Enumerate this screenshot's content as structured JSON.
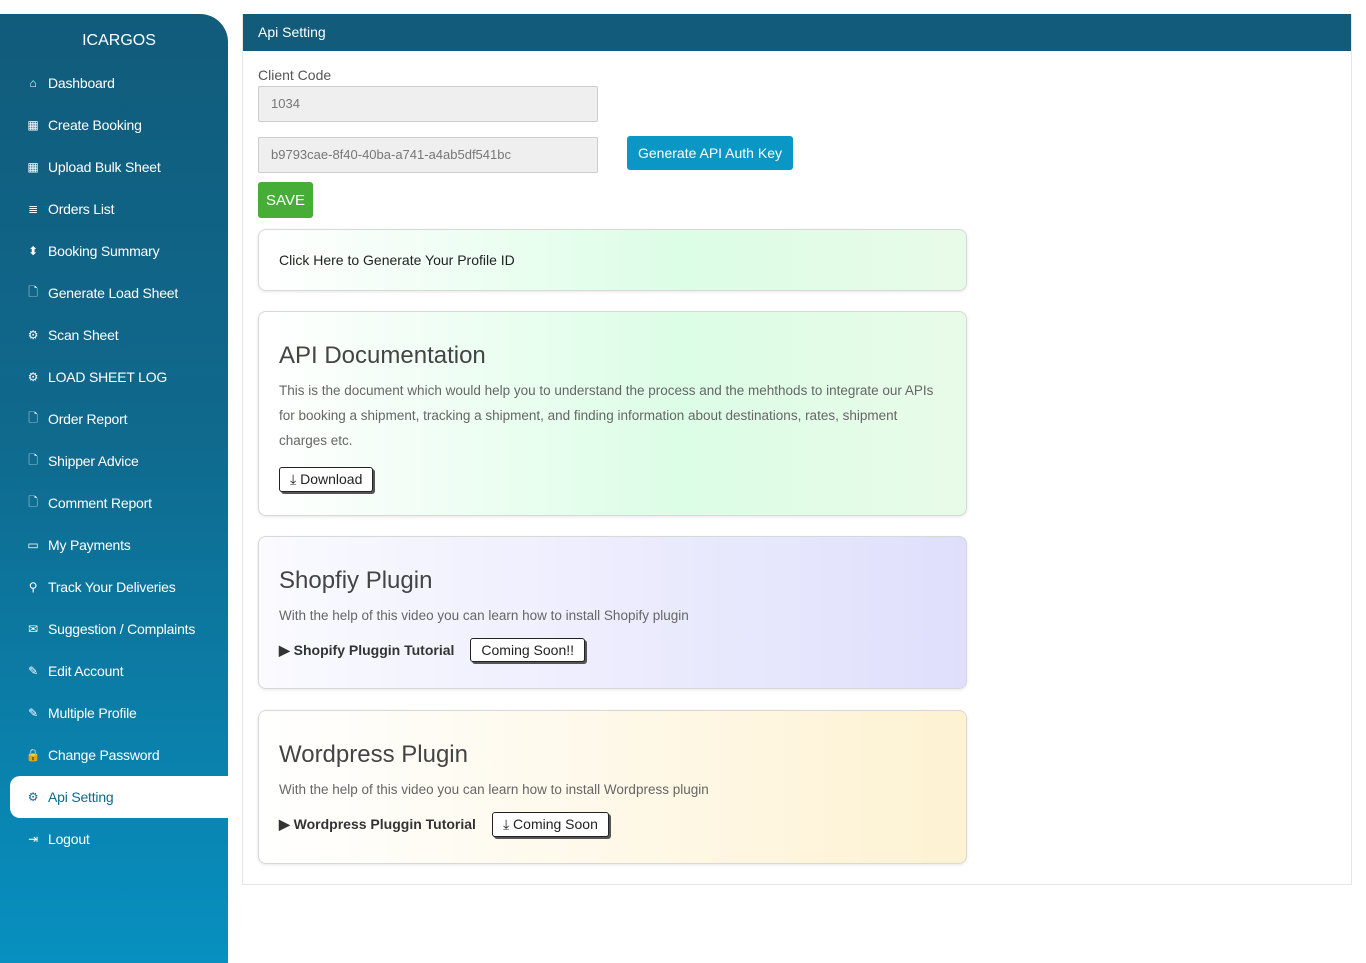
{
  "sidebar": {
    "brand": "ICARGOS",
    "items": [
      {
        "label": "Dashboard",
        "icon": "home-icon",
        "glyph": "⌂"
      },
      {
        "label": "Create Booking",
        "icon": "calendar-icon",
        "glyph": "▦"
      },
      {
        "label": "Upload Bulk Sheet",
        "icon": "calendar-icon",
        "glyph": "▦"
      },
      {
        "label": "Orders List",
        "icon": "list-icon",
        "glyph": "≣"
      },
      {
        "label": "Booking Summary",
        "icon": "sort-icon",
        "glyph": "⬍"
      },
      {
        "label": "Generate Load Sheet",
        "icon": "file-icon",
        "glyph": "🗋"
      },
      {
        "label": "Scan Sheet",
        "icon": "gear-icon",
        "glyph": "⚙"
      },
      {
        "label": "LOAD SHEET LOG",
        "icon": "gear-icon",
        "glyph": "⚙"
      },
      {
        "label": "Order Report",
        "icon": "file-icon",
        "glyph": "🗋"
      },
      {
        "label": "Shipper Advice",
        "icon": "file-icon",
        "glyph": "🗋"
      },
      {
        "label": "Comment Report",
        "icon": "file-icon",
        "glyph": "🗋"
      },
      {
        "label": "My Payments",
        "icon": "wallet-icon",
        "glyph": "▭"
      },
      {
        "label": "Track Your Deliveries",
        "icon": "location-icon",
        "glyph": "⚲"
      },
      {
        "label": "Suggestion / Complaints",
        "icon": "mail-icon",
        "glyph": "✉"
      },
      {
        "label": "Edit Account",
        "icon": "pencil-icon",
        "glyph": "✎"
      },
      {
        "label": "Multiple Profile",
        "icon": "pencil-icon",
        "glyph": "✎"
      },
      {
        "label": "Change Password",
        "icon": "lock-icon",
        "glyph": "🔒"
      },
      {
        "label": "Api Setting",
        "icon": "gear-icon",
        "glyph": "⚙",
        "active": true
      },
      {
        "label": "Logout",
        "icon": "logout-icon",
        "glyph": "⇥"
      }
    ]
  },
  "header": {
    "title": "Api Setting"
  },
  "form": {
    "client_code_label": "Client Code",
    "client_code": "1034",
    "api_key": "b9793cae-8f40-40ba-a741-a4ab5df541bc",
    "generate_label": "Generate API Auth Key",
    "save_label": "SAVE"
  },
  "profile_card": {
    "text": "Click Here to Generate Your Profile ID"
  },
  "api_doc": {
    "title": "API Documentation",
    "text": "This is the document which would help you to understand the process and the mehthods to integrate our APIs for booking a shipment, tracking a shipment, and finding information about destinations, rates, shipment charges etc.",
    "button": "Download"
  },
  "shopify": {
    "title": "Shopfiy Plugin",
    "text": "With the help of this video you can learn how to install Shopify plugin",
    "tutorial": "Shopify Pluggin Tutorial",
    "button": "Coming Soon!!"
  },
  "wordpress": {
    "title": "Wordpress Plugin",
    "text": "With the help of this video you can learn how to install Wordpress plugin",
    "tutorial": "Wordpress Pluggin Tutorial",
    "button": "Coming Soon"
  }
}
